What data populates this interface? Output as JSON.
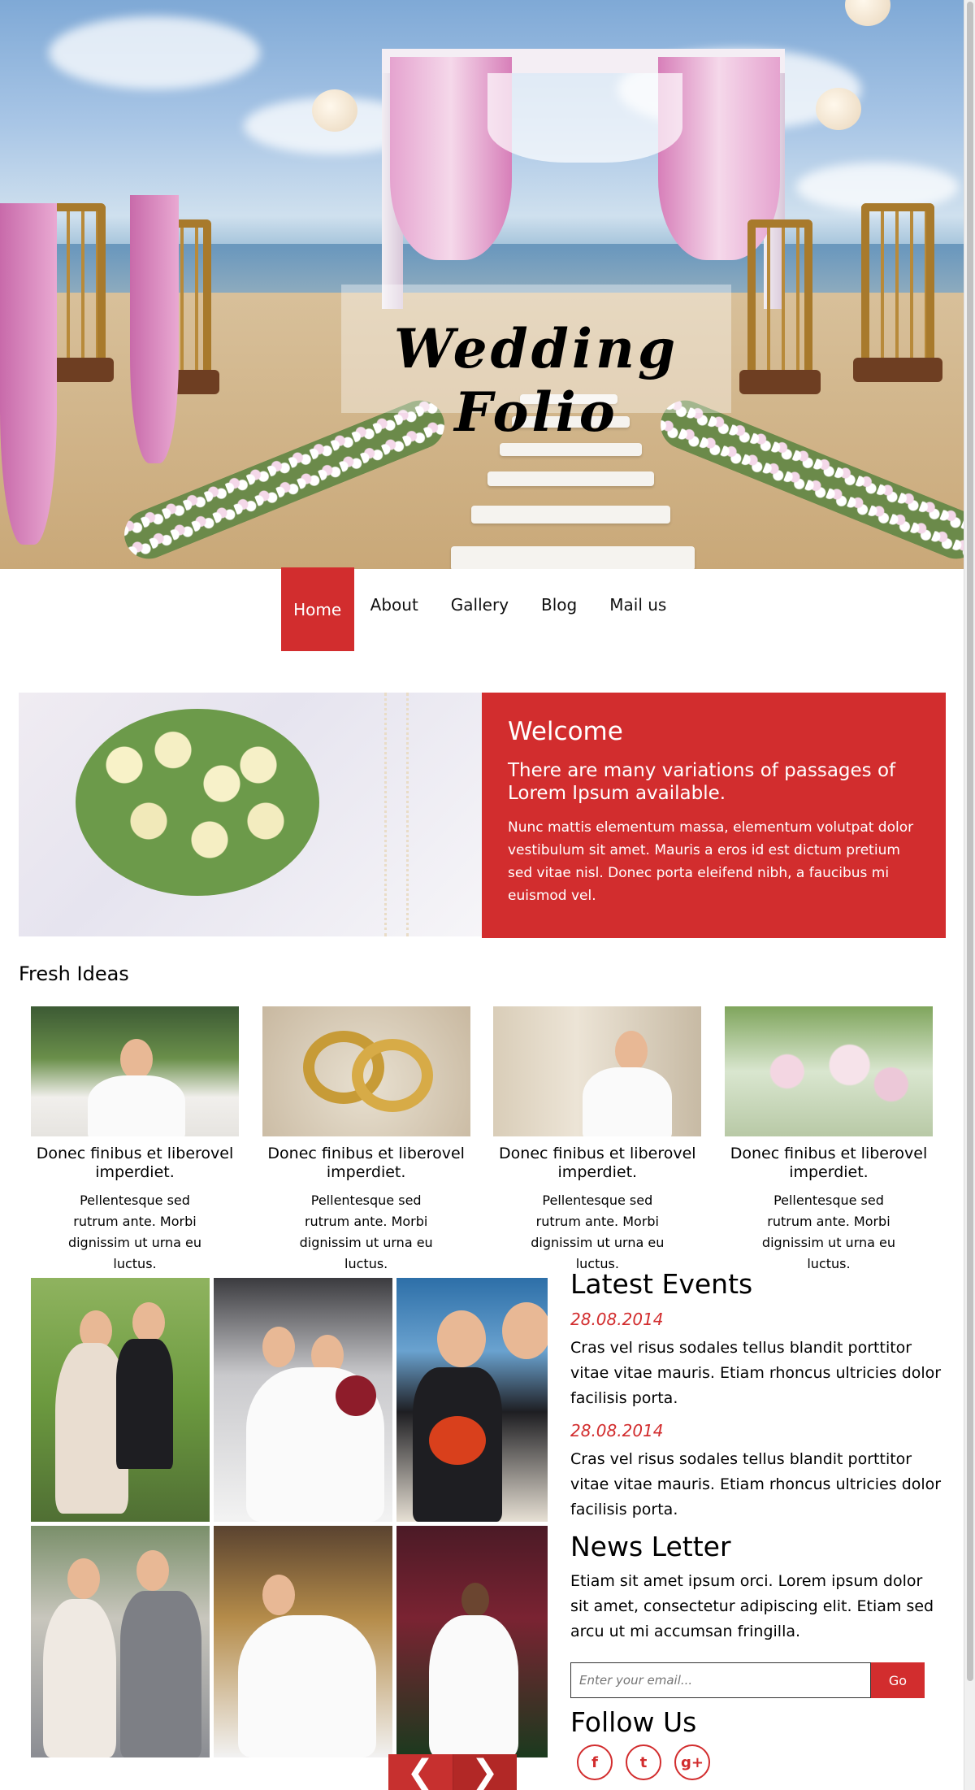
{
  "hero": {
    "title": "Wedding Folio"
  },
  "nav": {
    "items": [
      {
        "label": "Home",
        "active": true
      },
      {
        "label": "About",
        "active": false
      },
      {
        "label": "Gallery",
        "active": false
      },
      {
        "label": "Blog",
        "active": false
      },
      {
        "label": "Mail us",
        "active": false
      }
    ]
  },
  "welcome": {
    "title": "Welcome",
    "subtitle": "There are many variations of passages of Lorem Ipsum available.",
    "body": "Nunc mattis elementum massa, elementum volutpat dolor vestibulum sit amet. Mauris a eros id est dictum pretium sed vitae nisl. Donec porta eleifend nibh, a faucibus mi euismod vel."
  },
  "fresh_ideas": {
    "title": "Fresh Ideas",
    "items": [
      {
        "heading": "Donec finibus et liberovel imperdiet.",
        "text": "Pellentesque sed rutrum ante. Morbi dignissim ut urna eu luctus."
      },
      {
        "heading": "Donec finibus et liberovel imperdiet.",
        "text": "Pellentesque sed rutrum ante. Morbi dignissim ut urna eu luctus."
      },
      {
        "heading": "Donec finibus et liberovel imperdiet.",
        "text": "Pellentesque sed rutrum ante. Morbi dignissim ut urna eu luctus."
      },
      {
        "heading": "Donec finibus et liberovel imperdiet.",
        "text": "Pellentesque sed rutrum ante. Morbi dignissim ut urna eu luctus."
      }
    ]
  },
  "gallery": {
    "prev_icon": "chevron-left-icon",
    "next_icon": "chevron-right-icon"
  },
  "events": {
    "title": "Latest Events",
    "items": [
      {
        "date": "28.08.2014",
        "text": "Cras vel risus sodales tellus blandit porttitor vitae vitae mauris. Etiam rhoncus ultricies dolor facilisis porta."
      },
      {
        "date": "28.08.2014",
        "text": "Cras vel risus sodales tellus blandit porttitor vitae vitae mauris. Etiam rhoncus ultricies dolor facilisis porta."
      }
    ]
  },
  "newsletter": {
    "title": "News Letter",
    "text": "Etiam sit amet ipsum orci. Lorem ipsum dolor sit amet, consectetur adipiscing elit. Etiam sed arcu ut mi accumsan fringilla.",
    "placeholder": "Enter your email...",
    "button": "Go"
  },
  "follow": {
    "title": "Follow Us",
    "icons": [
      "facebook-icon",
      "twitter-icon",
      "google-plus-icon"
    ],
    "glyphs": [
      "f",
      "t",
      "g+"
    ]
  },
  "colors": {
    "accent": "#d22d2e",
    "text": "#000000",
    "background": "#ffffff"
  }
}
